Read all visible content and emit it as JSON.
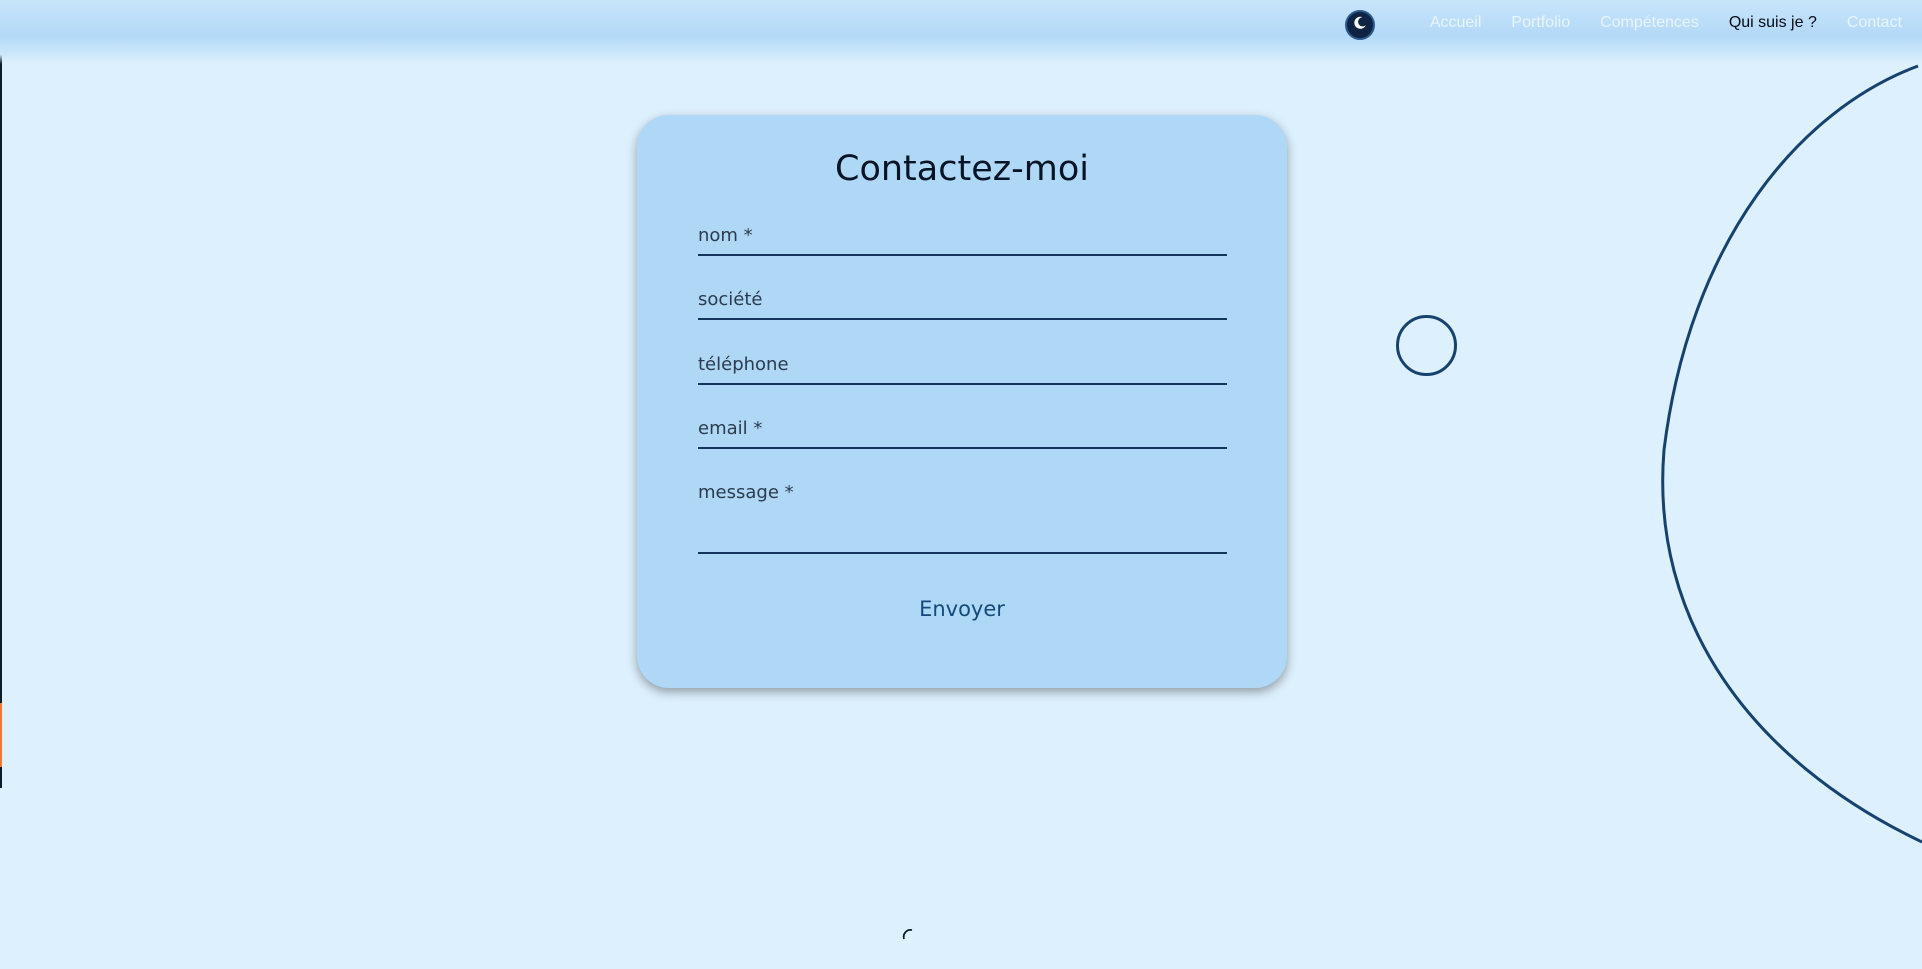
{
  "nav": {
    "theme_toggle_icon": "moon-icon",
    "items": [
      {
        "label": "Accueil",
        "active": false
      },
      {
        "label": "Portfolio",
        "active": false
      },
      {
        "label": "Compétences",
        "active": false
      },
      {
        "label": "Qui suis je ?",
        "active": true
      },
      {
        "label": "Contact",
        "active": false
      }
    ]
  },
  "contact": {
    "title": "Contactez-moi",
    "fields": {
      "nom": {
        "placeholder": "nom *",
        "value": ""
      },
      "societe": {
        "placeholder": "société",
        "value": ""
      },
      "telephone": {
        "placeholder": "téléphone",
        "value": ""
      },
      "email": {
        "placeholder": "email *",
        "value": ""
      },
      "message": {
        "placeholder": "message *",
        "value": ""
      }
    },
    "submit_label": "Envoyer"
  },
  "colors": {
    "background": "#ddf0fd",
    "card": "#afd8f6",
    "navy": "#15426e",
    "accent": "#f07a2c"
  }
}
